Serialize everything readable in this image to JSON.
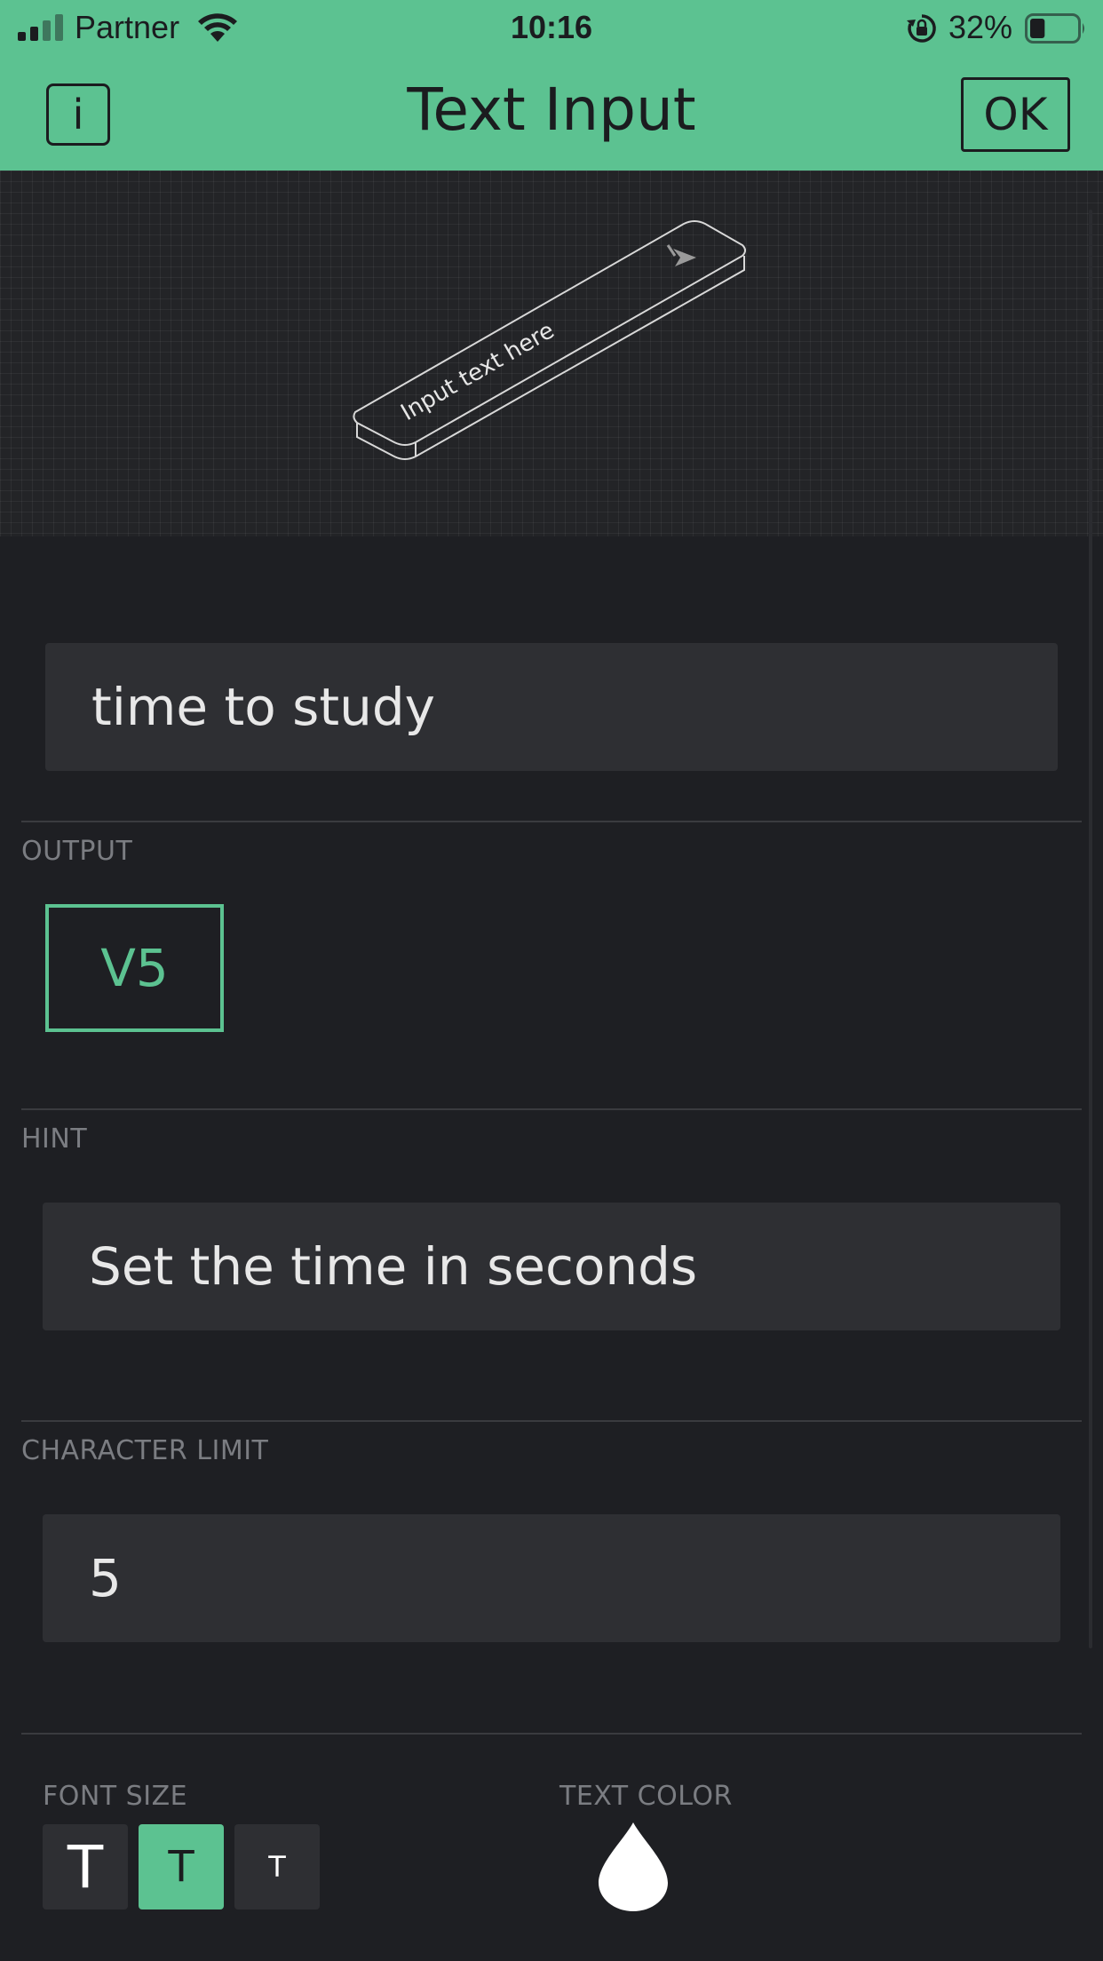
{
  "status_bar": {
    "carrier": "Partner",
    "time": "10:16",
    "battery_percent": "32%",
    "battery_level": 0.32
  },
  "nav": {
    "info_label": "i",
    "title": "Text Input",
    "ok_label": "OK"
  },
  "preview": {
    "placeholder": "Input text here"
  },
  "form": {
    "label_value": "time to study",
    "output": {
      "section_label": "OUTPUT",
      "pin": "V5"
    },
    "hint": {
      "section_label": "HINT",
      "value": "Set the time in seconds"
    },
    "character_limit": {
      "section_label": "CHARACTER LIMIT",
      "value": "5"
    },
    "font_size": {
      "section_label": "FONT SIZE",
      "options": [
        "T",
        "T",
        "T"
      ],
      "selected_index": 1
    },
    "text_color": {
      "section_label": "TEXT COLOR",
      "color": "#ffffff"
    }
  },
  "colors": {
    "accent": "#5cc291",
    "background": "#1e1f23",
    "field": "#2e2f33"
  }
}
